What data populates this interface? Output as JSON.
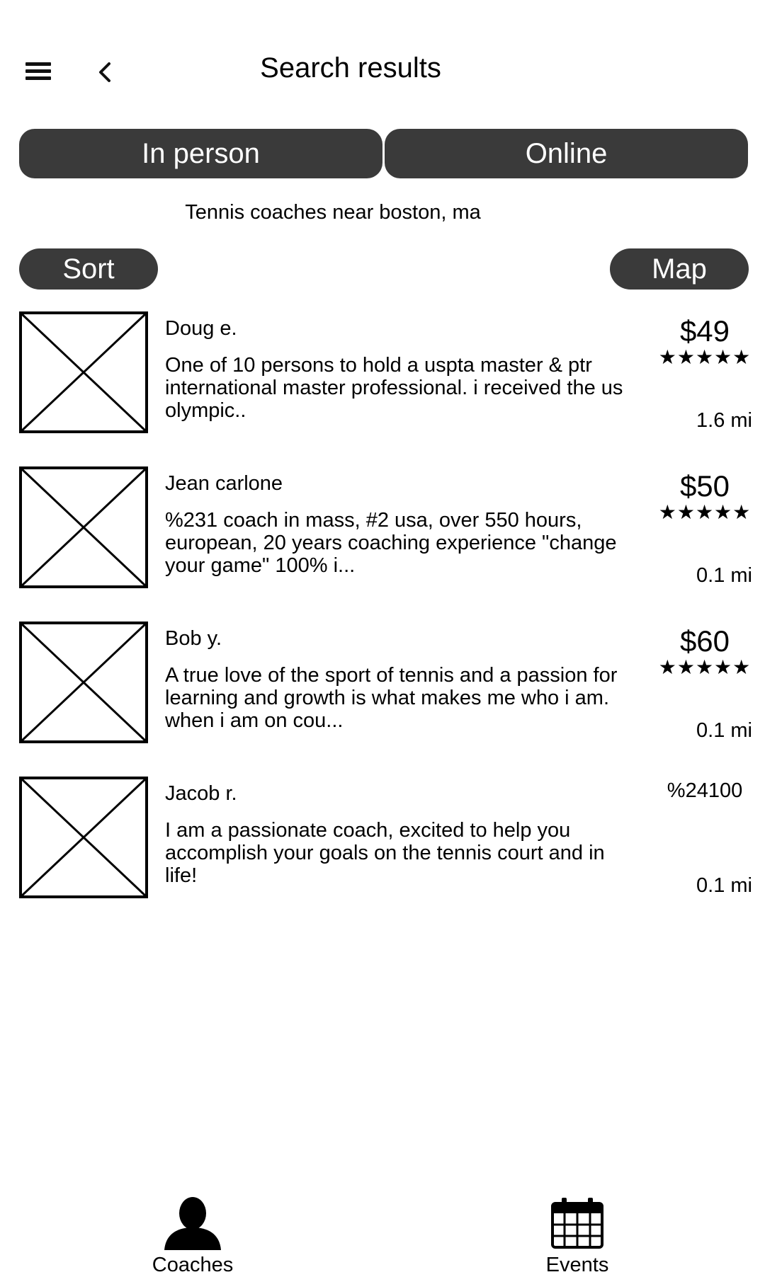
{
  "header": {
    "title": "Search results",
    "menu_icon": "hamburger-menu-icon",
    "back_icon": "chevron-left-icon"
  },
  "segments": {
    "in_person": "In person",
    "online": "Online"
  },
  "query": "Tennis coaches near boston, ma",
  "toolbar": {
    "sort_label": "Sort",
    "map_label": "Map"
  },
  "coaches": [
    {
      "name": "Doug e.",
      "description": "One of 10 persons to hold a uspta master & ptr international master professional. i received the us olympic..",
      "price": "$49",
      "stars": "★★★★★",
      "distance": "1.6 mi"
    },
    {
      "name": "Jean carlone",
      "description": "%231 coach in mass, #2 usa, over 550 hours, european, 20 years coaching experience \"change your game\" 100% i...",
      "price": "$50",
      "stars": "★★★★★",
      "distance": "0.1 mi"
    },
    {
      "name": "Bob y.",
      "description": "A true love of the sport of tennis and a passion for learning and growth is what makes me who i am. when i am on cou...",
      "price": "$60",
      "stars": "★★★★★",
      "distance": "0.1 mi"
    },
    {
      "name": "Jacob r.",
      "description": "I am a passionate coach, excited to help you accomplish your goals on the tennis court and in life!",
      "price": "%24100",
      "stars": "",
      "distance": "0.1 mi"
    }
  ],
  "bottom_nav": {
    "coaches_label": "Coaches",
    "coaches_icon": "person-icon",
    "events_label": "Events",
    "events_icon": "calendar-icon"
  },
  "colors": {
    "button_bg": "#3a3a3a",
    "button_text": "#ffffff",
    "background": "#ffffff"
  }
}
